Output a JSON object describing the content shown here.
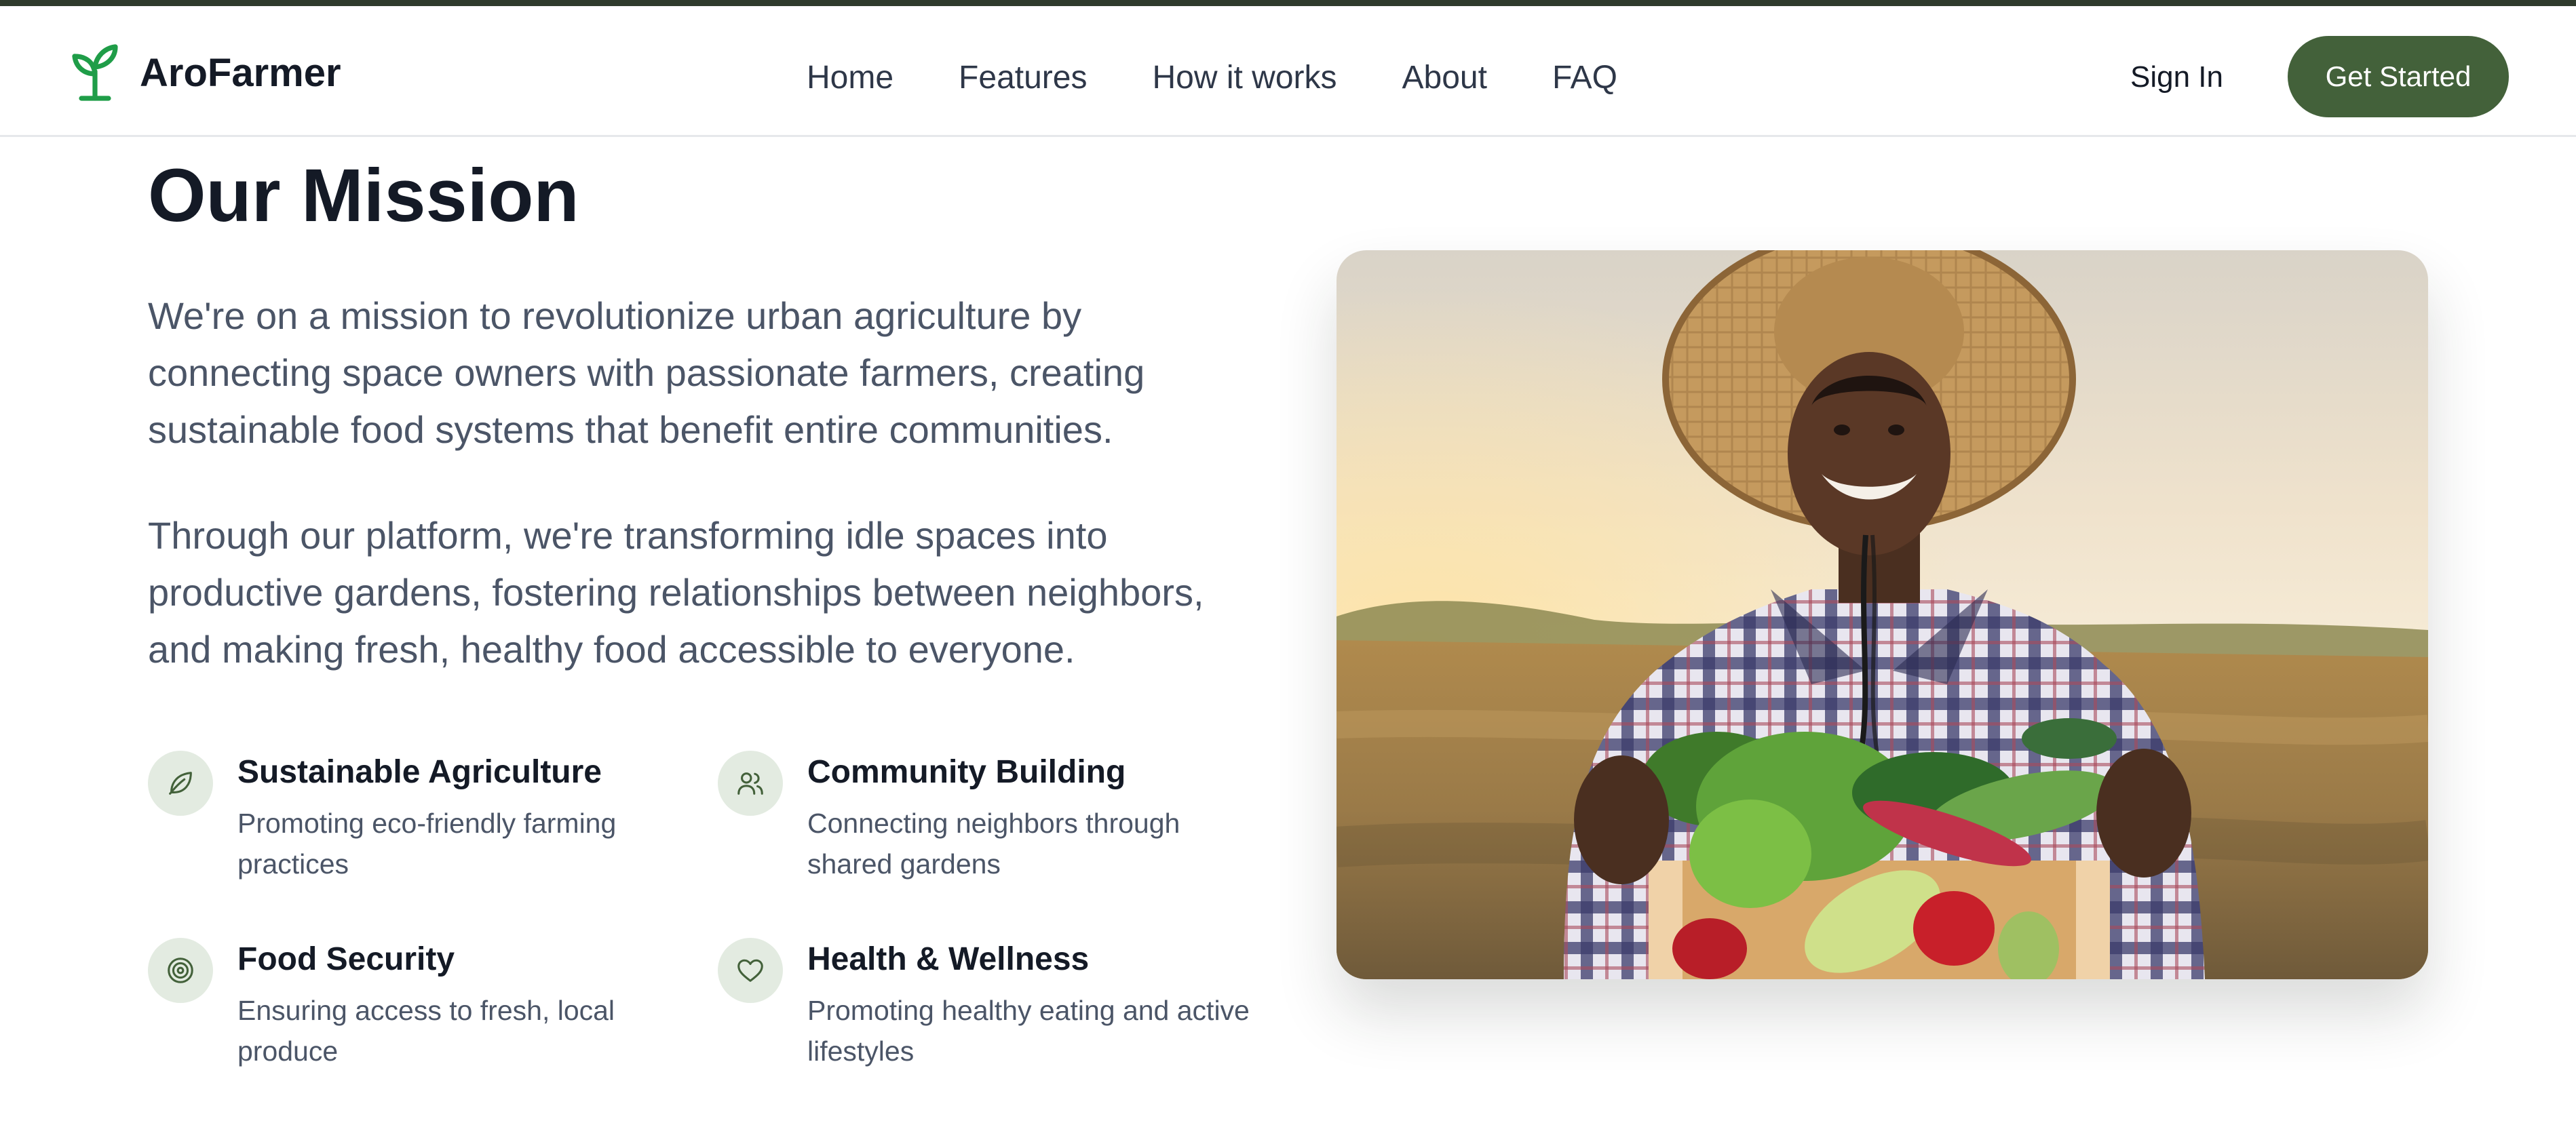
{
  "brand": {
    "name": "AroFarmer",
    "icon": "sprout-icon",
    "color": "#1f9d48"
  },
  "nav": {
    "links": [
      "Home",
      "Features",
      "How it works",
      "About",
      "FAQ"
    ],
    "sign_in": "Sign In",
    "cta": "Get Started",
    "cta_color": "#43613a"
  },
  "mission": {
    "title": "Our Mission",
    "paragraph_1": "We're on a mission to revolutionize urban agriculture by connecting space owners with passionate farmers, creating sustainable food systems that benefit entire communities.",
    "paragraph_2": "Through our platform, we're transforming idle spaces into productive gardens, fostering relationships between neighbors, and making fresh, healthy food accessible to everyone.",
    "features": [
      {
        "icon": "leaf-icon",
        "title": "Sustainable Agriculture",
        "description": "Promoting eco-friendly farming practices"
      },
      {
        "icon": "users-icon",
        "title": "Community Building",
        "description": "Connecting neighbors through shared gardens"
      },
      {
        "icon": "target-icon",
        "title": "Food Security",
        "description": "Ensuring access to fresh, local produce"
      },
      {
        "icon": "heart-icon",
        "title": "Health & Wellness",
        "description": "Promoting healthy eating and active lifestyles"
      }
    ]
  },
  "image": {
    "subject": "farmer-holding-vegetable-crate"
  }
}
